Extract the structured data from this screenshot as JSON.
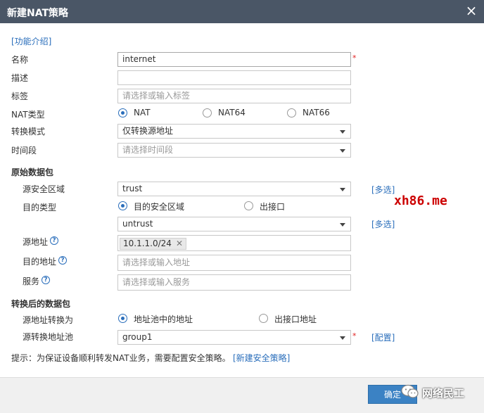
{
  "dialog": {
    "title": "新建NAT策略",
    "close_icon": "×"
  },
  "intro_link": "[功能介绍]",
  "fields": {
    "name_label": "名称",
    "name_value": "internet",
    "required_mark": "*",
    "desc_label": "描述",
    "tag_label": "标签",
    "tag_placeholder": "请选择或输入标签",
    "nat_type_label": "NAT类型",
    "nat_type_options": [
      "NAT",
      "NAT64",
      "NAT66"
    ],
    "mode_label": "转换模式",
    "mode_value": "仅转换源地址",
    "time_label": "时间段",
    "time_placeholder": "请选择时间段"
  },
  "original_packet": {
    "section": "原始数据包",
    "src_zone_label": "源安全区域",
    "src_zone_value": "trust",
    "multi_select": "[多选]",
    "dst_type_label": "目的类型",
    "dst_type_options": [
      "目的安全区域",
      "出接口"
    ],
    "dst_zone_value": "untrust",
    "src_addr_label": "源地址",
    "src_addr_tag": "10.1.1.0/24",
    "tag_remove": "✕",
    "help_icon": "?",
    "dst_addr_label": "目的地址",
    "dst_addr_placeholder": "请选择或输入地址",
    "service_label": "服务",
    "service_placeholder": "请选择或输入服务"
  },
  "translated_packet": {
    "section": "转换后的数据包",
    "translate_label": "源地址转换为",
    "translate_options": [
      "地址池中的地址",
      "出接口地址"
    ],
    "pool_label": "源转换地址池",
    "pool_value": "group1",
    "config_link": "[配置]"
  },
  "hint": {
    "text": "提示：为保证设备顺利转发NAT业务，需要配置安全策略。",
    "link": "[新建安全策略]"
  },
  "footer": {
    "ok_button": "确定"
  },
  "watermarks": {
    "site": "xh86.me",
    "wechat": "网络民工",
    "site_color": "#cc0000"
  }
}
